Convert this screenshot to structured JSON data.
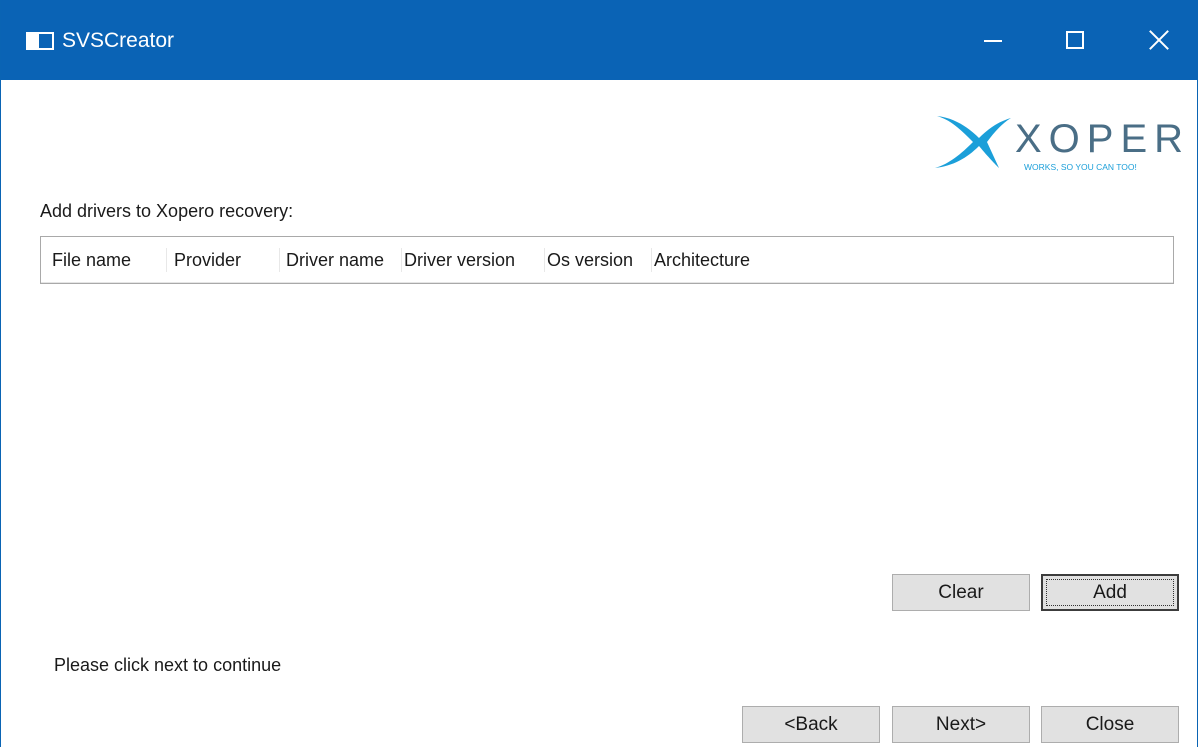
{
  "window": {
    "title": "SVSCreator"
  },
  "logo": {
    "text": "XOPERO",
    "tagline": "WORKS, SO YOU CAN TOO!",
    "colors": {
      "x_mark": "#1b9fd9",
      "letters": "#4a6e86",
      "tagline": "#1b9fd9"
    }
  },
  "drivers": {
    "label": "Add drivers to Xopero recovery:",
    "columns": [
      "File name",
      "Provider",
      "Driver name",
      "Driver version",
      "Os version",
      "Architecture"
    ],
    "rows": []
  },
  "buttons": {
    "clear": "Clear",
    "add": "Add",
    "back": "<Back",
    "next": "Next>",
    "close": "Close"
  },
  "status": "Please click next to continue",
  "colors": {
    "titlebar": "#0a63b5",
    "button_face": "#e1e1e1"
  },
  "icons": [
    "app-icon",
    "minimize-icon",
    "maximize-icon",
    "close-icon"
  ]
}
